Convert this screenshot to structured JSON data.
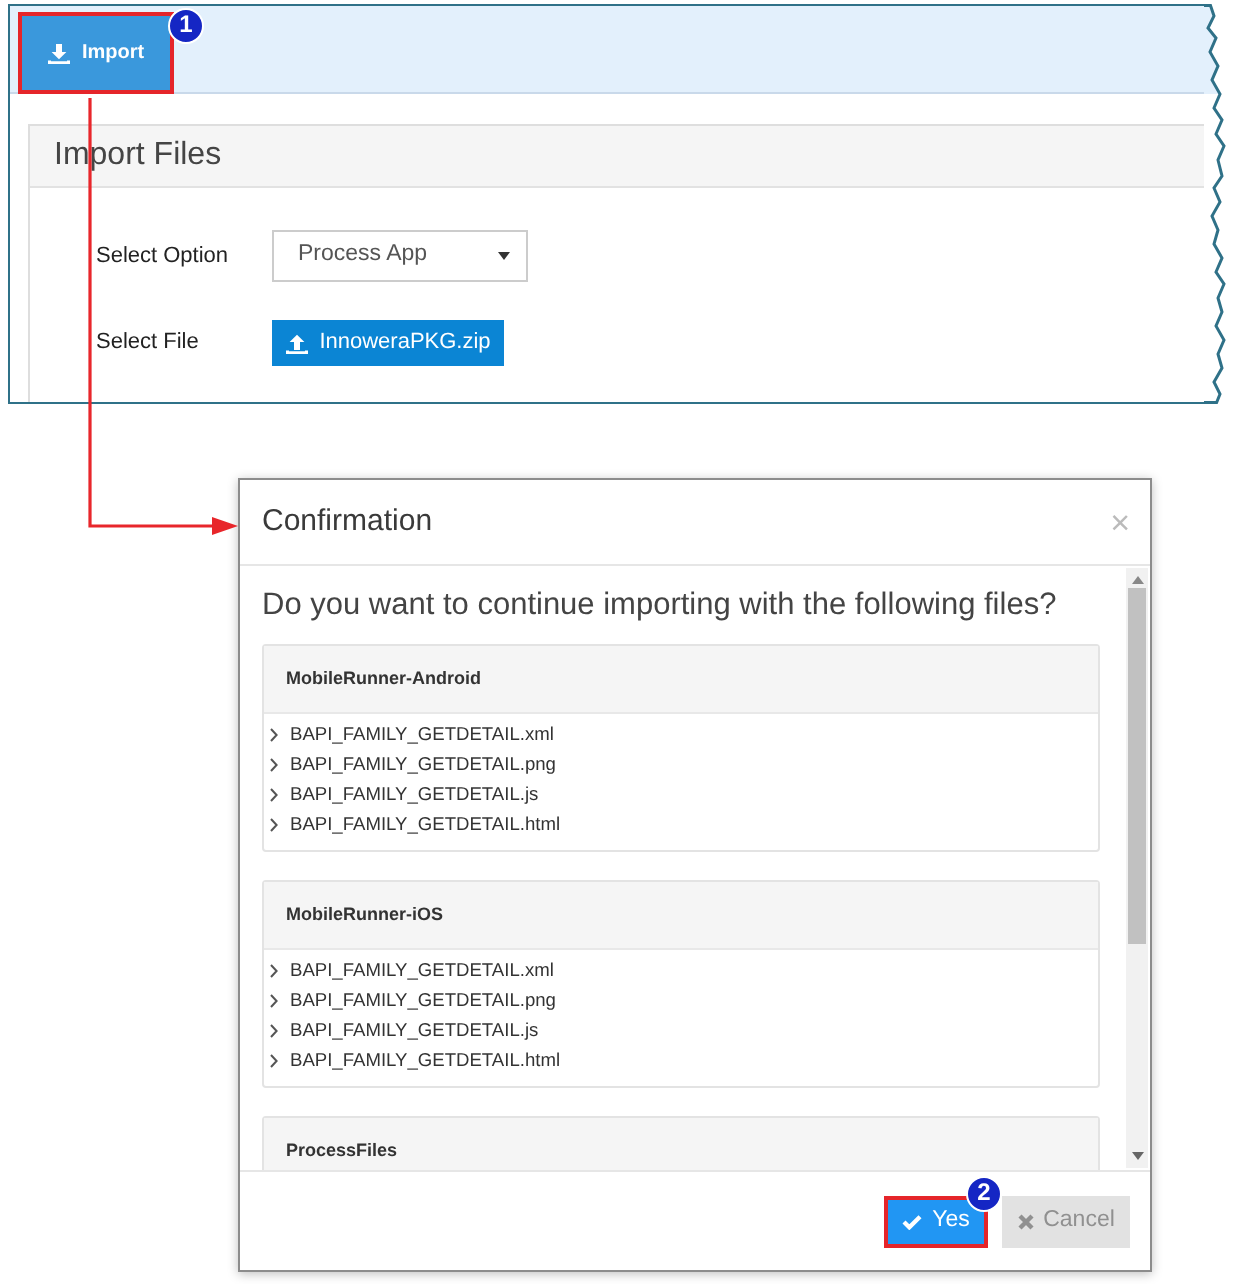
{
  "screenshot": {
    "top_bar": {
      "import_button": {
        "label": "Import",
        "highlighted": true,
        "callout": "1"
      }
    },
    "import_panel": {
      "title": "Import Files",
      "fields": [
        {
          "kind": "select",
          "label": "Select Option",
          "value": "Process App"
        },
        {
          "kind": "file",
          "label": "Select File",
          "value": "InnoweraPKG.zip"
        }
      ]
    }
  },
  "dialog": {
    "title": "Confirmation",
    "close": "×",
    "question": "Do you want to continue importing with the following files?",
    "groups": [
      {
        "name": "MobileRunner-Android",
        "files": [
          "BAPI_FAMILY_GETDETAIL.xml",
          "BAPI_FAMILY_GETDETAIL.png",
          "BAPI_FAMILY_GETDETAIL.js",
          "BAPI_FAMILY_GETDETAIL.html"
        ]
      },
      {
        "name": "MobileRunner-iOS",
        "files": [
          "BAPI_FAMILY_GETDETAIL.xml",
          "BAPI_FAMILY_GETDETAIL.png",
          "BAPI_FAMILY_GETDETAIL.js",
          "BAPI_FAMILY_GETDETAIL.html"
        ]
      },
      {
        "name": "ProcessFiles"
      }
    ],
    "buttons": [
      {
        "kind": "confirm",
        "label": "Yes",
        "highlighted": true,
        "callout": "2"
      },
      {
        "kind": "cancel",
        "label": "Cancel",
        "highlighted": false
      }
    ]
  }
}
